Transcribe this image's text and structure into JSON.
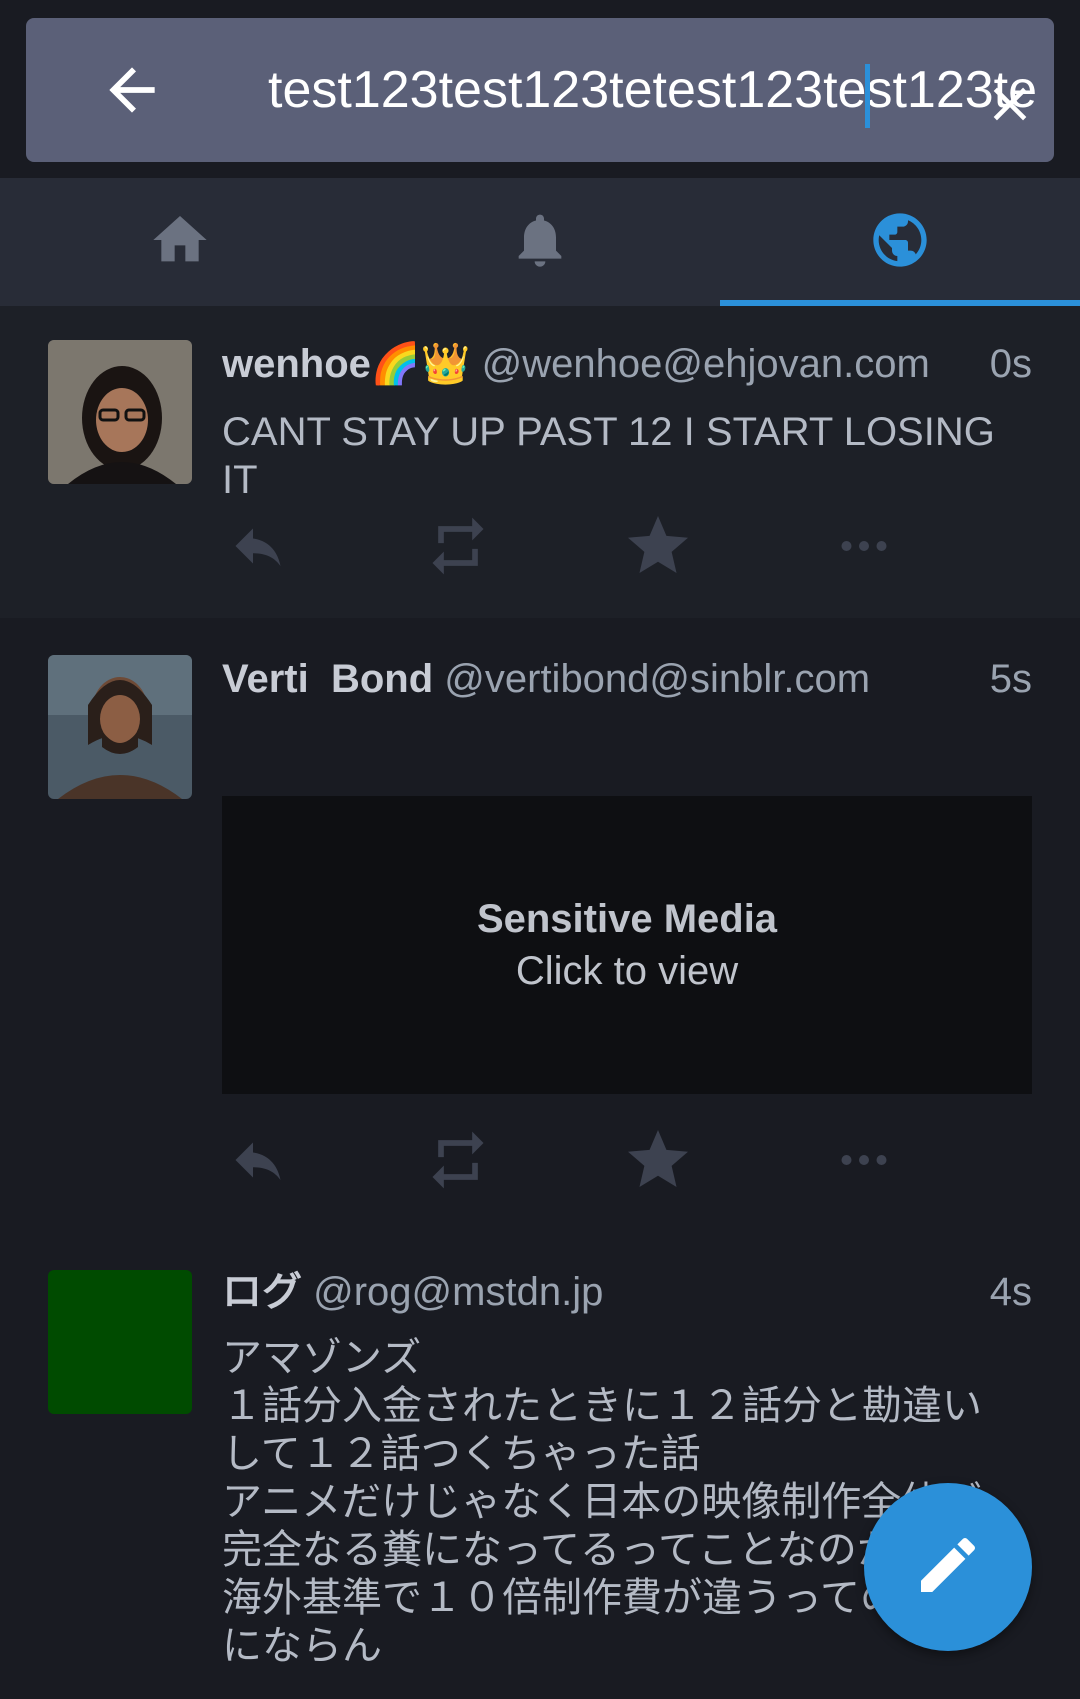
{
  "search": {
    "value": "test123test123tetest123test123te",
    "back_icon": "arrow-left-icon",
    "clear_icon": "close-icon"
  },
  "tabs": [
    {
      "icon": "home-icon",
      "active": false
    },
    {
      "icon": "bell-icon",
      "active": false
    },
    {
      "icon": "globe-icon",
      "active": true
    }
  ],
  "statuses": [
    {
      "display_name": "wenhoe🌈👑",
      "acct": "@wenhoe@ehjovan.com",
      "time": "0s",
      "content": "CANT STAY UP PAST 12 I START LOSING IT"
    },
    {
      "display_name": "Verti  Bond",
      "acct": "@vertibond@sinblr.com",
      "time": "5s",
      "media": {
        "title": "Sensitive Media",
        "subtitle": "Click to view"
      }
    },
    {
      "display_name": "ログ",
      "acct": "@rog@mstdn.jp",
      "time": "4s",
      "content_lines": [
        "アマゾンズ",
        "１話分入金されたときに１２話分と勘違い",
        "して１２話つくちゃった話",
        "アニメだけじゃなく日本の映像制作全体が",
        "完全なる糞になってるってことなのか",
        "海外基準で１０倍制作費が違うってのは話",
        "にならん"
      ]
    }
  ],
  "fab": {
    "icon": "pencil-icon"
  },
  "colors": {
    "accent": "#2b90d9",
    "background": "#191b22",
    "search_bg": "#5b6078"
  }
}
